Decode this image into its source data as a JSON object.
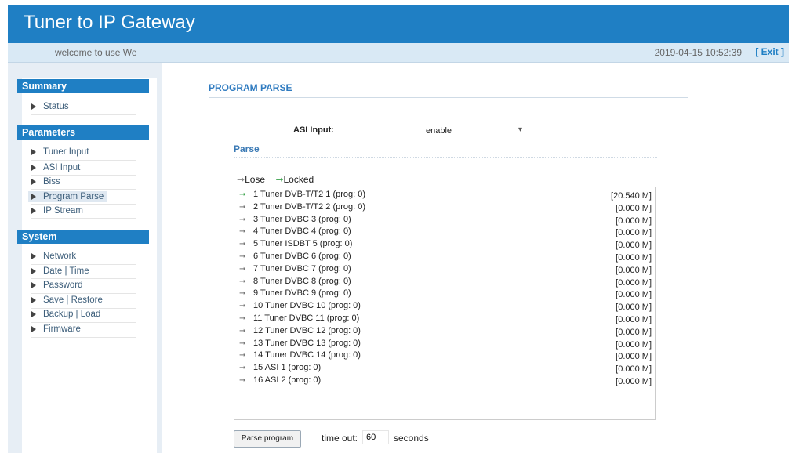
{
  "app": {
    "title": "Tuner to IP Gateway",
    "welcome": "welcome to use We",
    "datetime": "2019-04-15 10:52:39",
    "exit_label": "[ Exit ]"
  },
  "sidebar": {
    "sections": [
      {
        "title": "Summary",
        "items": [
          "Status"
        ]
      },
      {
        "title": "Parameters",
        "items": [
          "Tuner Input",
          "ASI Input",
          "Biss",
          "Program Parse",
          "IP Stream"
        ]
      },
      {
        "title": "System",
        "items": [
          "Network",
          "Date | Time",
          "Password",
          "Save | Restore",
          "Backup | Load",
          "Firmware"
        ]
      }
    ],
    "active_item": "Program Parse"
  },
  "main": {
    "page_title": "PROGRAM PARSE",
    "asi_input_label": "ASI Input:",
    "asi_input_value": "enable",
    "parse_label": "Parse",
    "legend": {
      "lose": "Lose",
      "locked": "Locked"
    },
    "programs": [
      {
        "label": "1 Tuner DVB-T/T2 1 (prog: 0)",
        "rate": "[20.540 M]",
        "locked": true
      },
      {
        "label": "2 Tuner DVB-T/T2 2 (prog: 0)",
        "rate": "[0.000 M]",
        "locked": false
      },
      {
        "label": "3 Tuner DVBC 3 (prog: 0)",
        "rate": "[0.000 M]",
        "locked": false
      },
      {
        "label": "4 Tuner DVBC 4 (prog: 0)",
        "rate": "[0.000 M]",
        "locked": false
      },
      {
        "label": "5 Tuner ISDBT 5 (prog: 0)",
        "rate": "[0.000 M]",
        "locked": false
      },
      {
        "label": "6 Tuner DVBC 6 (prog: 0)",
        "rate": "[0.000 M]",
        "locked": false
      },
      {
        "label": "7 Tuner DVBC 7 (prog: 0)",
        "rate": "[0.000 M]",
        "locked": false
      },
      {
        "label": "8 Tuner DVBC 8 (prog: 0)",
        "rate": "[0.000 M]",
        "locked": false
      },
      {
        "label": "9 Tuner DVBC 9 (prog: 0)",
        "rate": "[0.000 M]",
        "locked": false
      },
      {
        "label": "10 Tuner DVBC 10 (prog: 0)",
        "rate": "[0.000 M]",
        "locked": false
      },
      {
        "label": "11 Tuner DVBC 11 (prog: 0)",
        "rate": "[0.000 M]",
        "locked": false
      },
      {
        "label": "12 Tuner DVBC 12 (prog: 0)",
        "rate": "[0.000 M]",
        "locked": false
      },
      {
        "label": "13 Tuner DVBC 13 (prog: 0)",
        "rate": "[0.000 M]",
        "locked": false
      },
      {
        "label": "14 Tuner DVBC 14 (prog: 0)",
        "rate": "[0.000 M]",
        "locked": false
      },
      {
        "label": "15 ASI 1 (prog: 0)",
        "rate": "[0.000 M]",
        "locked": false
      },
      {
        "label": "16 ASI 2 (prog: 0)",
        "rate": "[0.000 M]",
        "locked": false
      }
    ],
    "parse_button_label": "Parse program",
    "timeout_label": "time out:",
    "timeout_value": "60",
    "seconds_label": "seconds"
  },
  "colors": {
    "header": "#1f7fc4",
    "locked_arrow": "#3aa24b",
    "lose_arrow": "#888888"
  }
}
